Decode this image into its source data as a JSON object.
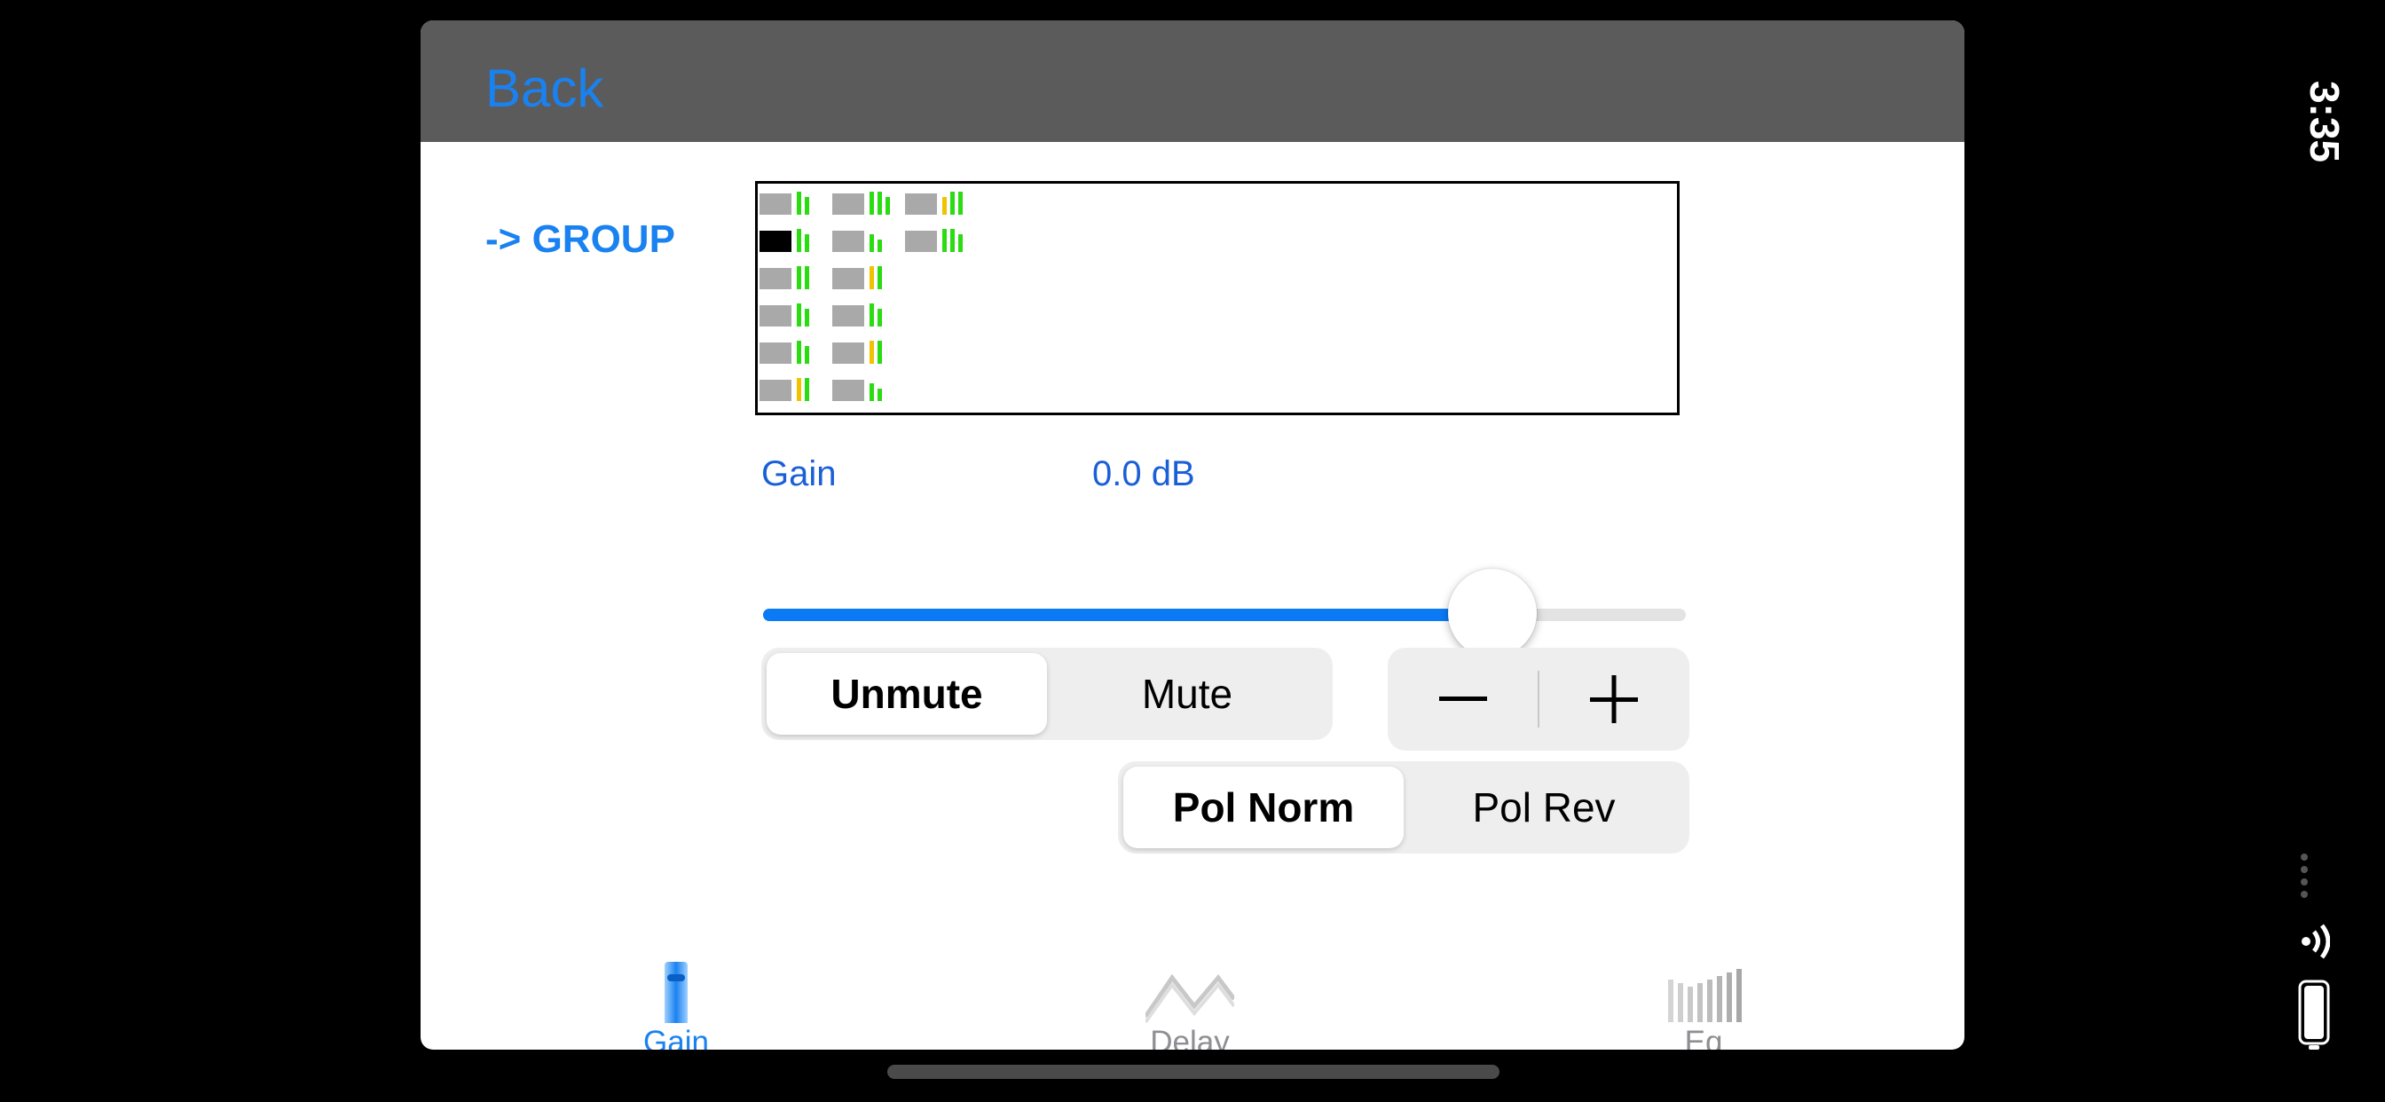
{
  "status_bar": {
    "time": "3:35"
  },
  "nav": {
    "back_label": "Back"
  },
  "group_label": "-> GROUP",
  "gain": {
    "label": "Gain",
    "value": "0.0 dB",
    "slider_level": 0.79
  },
  "mute": {
    "options": [
      "Unmute",
      "Mute"
    ],
    "selected": "Unmute"
  },
  "stepper": {
    "minus": "−",
    "plus": "+"
  },
  "polarity": {
    "options": [
      "Pol Norm",
      "Pol Rev"
    ],
    "selected": "Pol Norm"
  },
  "tabs": [
    {
      "label": "Gain",
      "icon": "fader-icon",
      "active": true
    },
    {
      "label": "Delay",
      "icon": "delay-wave-icon",
      "active": false
    },
    {
      "label": "Eq",
      "icon": "eq-bars-icon",
      "active": false
    }
  ],
  "colors": {
    "accent": "#1a82f0",
    "meter_green": "#2bdc12",
    "meter_yellow": "#f2c200",
    "meter_gray": "#a9a9a9",
    "navbar": "#5b5b5b"
  }
}
